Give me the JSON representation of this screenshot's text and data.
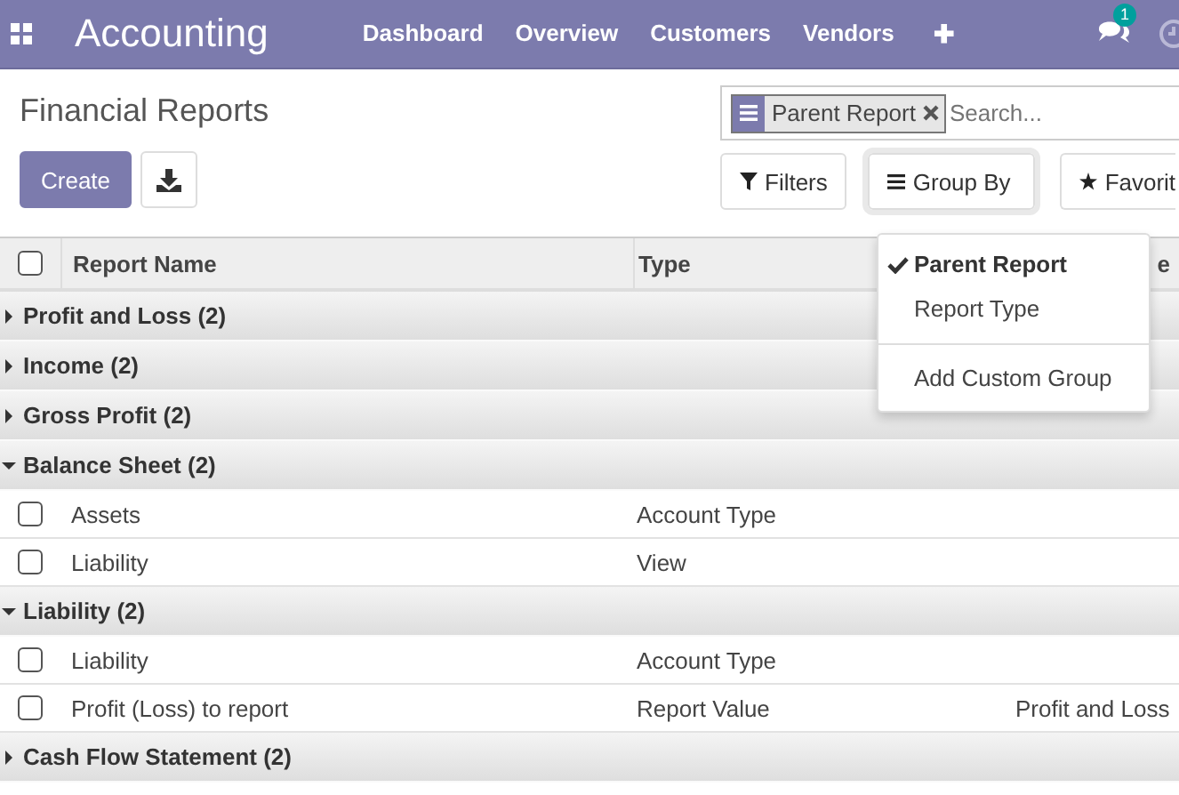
{
  "navbar": {
    "app_title": "Accounting",
    "menu": [
      "Dashboard",
      "Overview",
      "Customers",
      "Vendors"
    ],
    "add_symbol": "✚",
    "messages_badge": "1"
  },
  "breadcrumb": "Financial Reports",
  "search": {
    "facets": [
      {
        "label": "Parent Report"
      }
    ],
    "placeholder": "Search..."
  },
  "create_button": "Create",
  "search_buttons": [
    {
      "label": "Filters",
      "kind": "filter",
      "selected": false
    },
    {
      "label": "Group By",
      "kind": "group",
      "selected": true
    },
    {
      "label": "Favorit",
      "kind": "star",
      "selected": false
    }
  ],
  "group_by_menu": {
    "options": [
      {
        "label": "Parent Report",
        "checked": true
      },
      {
        "label": "Report Type",
        "checked": false
      }
    ],
    "custom_group": "Add Custom Group"
  },
  "table": {
    "select_all_checked": false,
    "columns": [
      {
        "label": "Report Name"
      },
      {
        "label": "Type"
      },
      {
        "label": "e"
      }
    ],
    "groups": [
      {
        "label": "Profit and Loss (2)",
        "expanded": false
      },
      {
        "label": "Income (2)",
        "expanded": false
      },
      {
        "label": "Gross Profit (2)",
        "expanded": false
      },
      {
        "label": "Balance Sheet (2)",
        "expanded": true,
        "rows": [
          {
            "name": "Assets",
            "type": "Account Type",
            "checked": false
          },
          {
            "name": "Liability",
            "type": "View",
            "checked": false
          }
        ]
      },
      {
        "label": "Liability (2)",
        "expanded": true,
        "rows": [
          {
            "name": "Liability",
            "type": "Account Type",
            "checked": false
          },
          {
            "name": "Profit (Loss) to report",
            "type": "Report Value",
            "column_3": "Profit and Loss",
            "checked": false
          }
        ]
      },
      {
        "label": "Cash Flow Statement (2)",
        "expanded": false
      }
    ]
  }
}
